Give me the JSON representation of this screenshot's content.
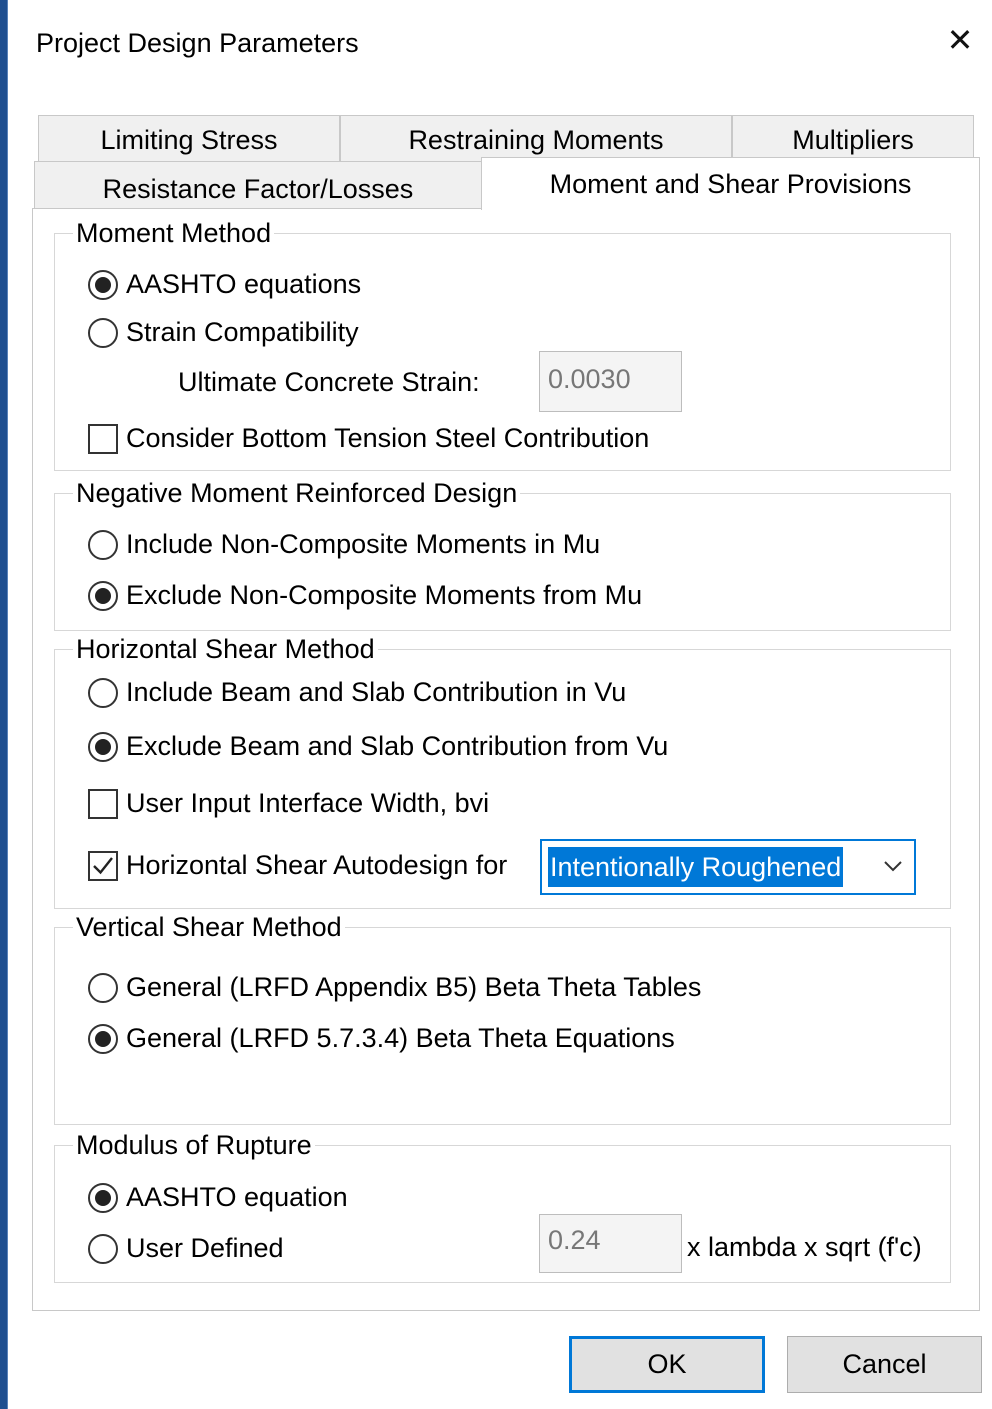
{
  "window": {
    "title": "Project Design Parameters",
    "close_glyph": "✕"
  },
  "tabs": {
    "row_back": [
      "Limiting Stress",
      "Restraining Moments",
      "Multipliers"
    ],
    "row_front": [
      "Resistance Factor/Losses",
      "Moment and Shear Provisions"
    ],
    "active": "Moment and Shear Provisions"
  },
  "moment_method": {
    "legend": "Moment Method",
    "opt_aashto": "AASHTO equations",
    "opt_strain": "Strain Compatibility",
    "selected": "AASHTO equations",
    "ult_strain_label": "Ultimate Concrete Strain:",
    "ult_strain_value": "0.0030",
    "bottom_steel_label": "Consider Bottom Tension Steel Contribution",
    "bottom_steel_checked": false
  },
  "neg_moment": {
    "legend": "Negative Moment Reinforced Design",
    "opt_include": "Include Non-Composite Moments in Mu",
    "opt_exclude": "Exclude Non-Composite Moments from Mu",
    "selected": "Exclude Non-Composite Moments from Mu"
  },
  "horiz_shear": {
    "legend": "Horizontal Shear Method",
    "opt_include": "Include Beam and Slab Contribution in Vu",
    "opt_exclude": "Exclude Beam and Slab Contribution from Vu",
    "selected": "Exclude Beam and Slab Contribution from Vu",
    "user_bvi_label": "User Input Interface Width, bvi",
    "user_bvi_checked": false,
    "autodesign_label": "Horizontal Shear Autodesign for",
    "autodesign_checked": true,
    "autodesign_value": "Intentionally Roughened"
  },
  "vert_shear": {
    "legend": "Vertical Shear Method",
    "opt_tables": "General (LRFD Appendix B5) Beta Theta Tables",
    "opt_equations": "General (LRFD 5.7.3.4) Beta Theta Equations",
    "selected": "General (LRFD 5.7.3.4) Beta Theta Equations"
  },
  "rupture": {
    "legend": "Modulus of Rupture",
    "opt_aashto": "AASHTO equation",
    "opt_user": "User Defined",
    "selected": "AASHTO equation",
    "factor_value": "0.24",
    "factor_suffix": "x lambda x sqrt (f'c)"
  },
  "buttons": {
    "ok": "OK",
    "cancel": "Cancel"
  },
  "colors": {
    "accent": "#0078d7",
    "window_border": "#1f4f8f",
    "button_face": "#e1e1e1"
  },
  "icons": {
    "close": "close-icon",
    "dropdown": "chevron-down-icon",
    "check": "checkmark-icon"
  }
}
